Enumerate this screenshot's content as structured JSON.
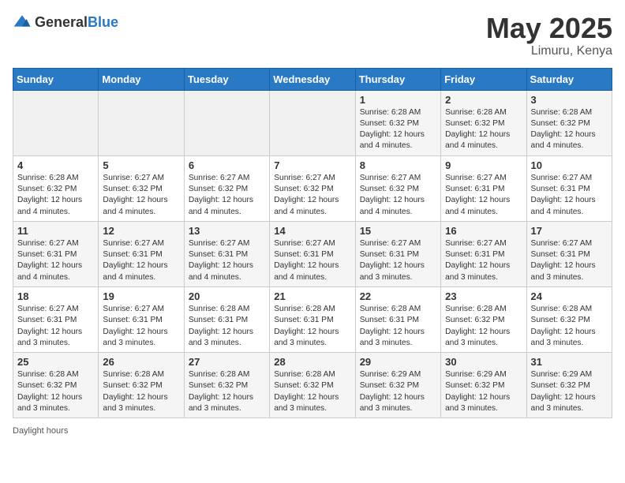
{
  "header": {
    "logo_general": "General",
    "logo_blue": "Blue",
    "month_title": "May 2025",
    "location": "Limuru, Kenya"
  },
  "days_of_week": [
    "Sunday",
    "Monday",
    "Tuesday",
    "Wednesday",
    "Thursday",
    "Friday",
    "Saturday"
  ],
  "weeks": [
    [
      {
        "num": "",
        "sunrise": "",
        "sunset": "",
        "daylight": ""
      },
      {
        "num": "",
        "sunrise": "",
        "sunset": "",
        "daylight": ""
      },
      {
        "num": "",
        "sunrise": "",
        "sunset": "",
        "daylight": ""
      },
      {
        "num": "",
        "sunrise": "",
        "sunset": "",
        "daylight": ""
      },
      {
        "num": "1",
        "sunrise": "Sunrise: 6:28 AM",
        "sunset": "Sunset: 6:32 PM",
        "daylight": "Daylight: 12 hours and 4 minutes."
      },
      {
        "num": "2",
        "sunrise": "Sunrise: 6:28 AM",
        "sunset": "Sunset: 6:32 PM",
        "daylight": "Daylight: 12 hours and 4 minutes."
      },
      {
        "num": "3",
        "sunrise": "Sunrise: 6:28 AM",
        "sunset": "Sunset: 6:32 PM",
        "daylight": "Daylight: 12 hours and 4 minutes."
      }
    ],
    [
      {
        "num": "4",
        "sunrise": "Sunrise: 6:28 AM",
        "sunset": "Sunset: 6:32 PM",
        "daylight": "Daylight: 12 hours and 4 minutes."
      },
      {
        "num": "5",
        "sunrise": "Sunrise: 6:27 AM",
        "sunset": "Sunset: 6:32 PM",
        "daylight": "Daylight: 12 hours and 4 minutes."
      },
      {
        "num": "6",
        "sunrise": "Sunrise: 6:27 AM",
        "sunset": "Sunset: 6:32 PM",
        "daylight": "Daylight: 12 hours and 4 minutes."
      },
      {
        "num": "7",
        "sunrise": "Sunrise: 6:27 AM",
        "sunset": "Sunset: 6:32 PM",
        "daylight": "Daylight: 12 hours and 4 minutes."
      },
      {
        "num": "8",
        "sunrise": "Sunrise: 6:27 AM",
        "sunset": "Sunset: 6:32 PM",
        "daylight": "Daylight: 12 hours and 4 minutes."
      },
      {
        "num": "9",
        "sunrise": "Sunrise: 6:27 AM",
        "sunset": "Sunset: 6:31 PM",
        "daylight": "Daylight: 12 hours and 4 minutes."
      },
      {
        "num": "10",
        "sunrise": "Sunrise: 6:27 AM",
        "sunset": "Sunset: 6:31 PM",
        "daylight": "Daylight: 12 hours and 4 minutes."
      }
    ],
    [
      {
        "num": "11",
        "sunrise": "Sunrise: 6:27 AM",
        "sunset": "Sunset: 6:31 PM",
        "daylight": "Daylight: 12 hours and 4 minutes."
      },
      {
        "num": "12",
        "sunrise": "Sunrise: 6:27 AM",
        "sunset": "Sunset: 6:31 PM",
        "daylight": "Daylight: 12 hours and 4 minutes."
      },
      {
        "num": "13",
        "sunrise": "Sunrise: 6:27 AM",
        "sunset": "Sunset: 6:31 PM",
        "daylight": "Daylight: 12 hours and 4 minutes."
      },
      {
        "num": "14",
        "sunrise": "Sunrise: 6:27 AM",
        "sunset": "Sunset: 6:31 PM",
        "daylight": "Daylight: 12 hours and 4 minutes."
      },
      {
        "num": "15",
        "sunrise": "Sunrise: 6:27 AM",
        "sunset": "Sunset: 6:31 PM",
        "daylight": "Daylight: 12 hours and 3 minutes."
      },
      {
        "num": "16",
        "sunrise": "Sunrise: 6:27 AM",
        "sunset": "Sunset: 6:31 PM",
        "daylight": "Daylight: 12 hours and 3 minutes."
      },
      {
        "num": "17",
        "sunrise": "Sunrise: 6:27 AM",
        "sunset": "Sunset: 6:31 PM",
        "daylight": "Daylight: 12 hours and 3 minutes."
      }
    ],
    [
      {
        "num": "18",
        "sunrise": "Sunrise: 6:27 AM",
        "sunset": "Sunset: 6:31 PM",
        "daylight": "Daylight: 12 hours and 3 minutes."
      },
      {
        "num": "19",
        "sunrise": "Sunrise: 6:27 AM",
        "sunset": "Sunset: 6:31 PM",
        "daylight": "Daylight: 12 hours and 3 minutes."
      },
      {
        "num": "20",
        "sunrise": "Sunrise: 6:28 AM",
        "sunset": "Sunset: 6:31 PM",
        "daylight": "Daylight: 12 hours and 3 minutes."
      },
      {
        "num": "21",
        "sunrise": "Sunrise: 6:28 AM",
        "sunset": "Sunset: 6:31 PM",
        "daylight": "Daylight: 12 hours and 3 minutes."
      },
      {
        "num": "22",
        "sunrise": "Sunrise: 6:28 AM",
        "sunset": "Sunset: 6:31 PM",
        "daylight": "Daylight: 12 hours and 3 minutes."
      },
      {
        "num": "23",
        "sunrise": "Sunrise: 6:28 AM",
        "sunset": "Sunset: 6:32 PM",
        "daylight": "Daylight: 12 hours and 3 minutes."
      },
      {
        "num": "24",
        "sunrise": "Sunrise: 6:28 AM",
        "sunset": "Sunset: 6:32 PM",
        "daylight": "Daylight: 12 hours and 3 minutes."
      }
    ],
    [
      {
        "num": "25",
        "sunrise": "Sunrise: 6:28 AM",
        "sunset": "Sunset: 6:32 PM",
        "daylight": "Daylight: 12 hours and 3 minutes."
      },
      {
        "num": "26",
        "sunrise": "Sunrise: 6:28 AM",
        "sunset": "Sunset: 6:32 PM",
        "daylight": "Daylight: 12 hours and 3 minutes."
      },
      {
        "num": "27",
        "sunrise": "Sunrise: 6:28 AM",
        "sunset": "Sunset: 6:32 PM",
        "daylight": "Daylight: 12 hours and 3 minutes."
      },
      {
        "num": "28",
        "sunrise": "Sunrise: 6:28 AM",
        "sunset": "Sunset: 6:32 PM",
        "daylight": "Daylight: 12 hours and 3 minutes."
      },
      {
        "num": "29",
        "sunrise": "Sunrise: 6:29 AM",
        "sunset": "Sunset: 6:32 PM",
        "daylight": "Daylight: 12 hours and 3 minutes."
      },
      {
        "num": "30",
        "sunrise": "Sunrise: 6:29 AM",
        "sunset": "Sunset: 6:32 PM",
        "daylight": "Daylight: 12 hours and 3 minutes."
      },
      {
        "num": "31",
        "sunrise": "Sunrise: 6:29 AM",
        "sunset": "Sunset: 6:32 PM",
        "daylight": "Daylight: 12 hours and 3 minutes."
      }
    ]
  ],
  "footer": {
    "daylight_label": "Daylight hours"
  }
}
